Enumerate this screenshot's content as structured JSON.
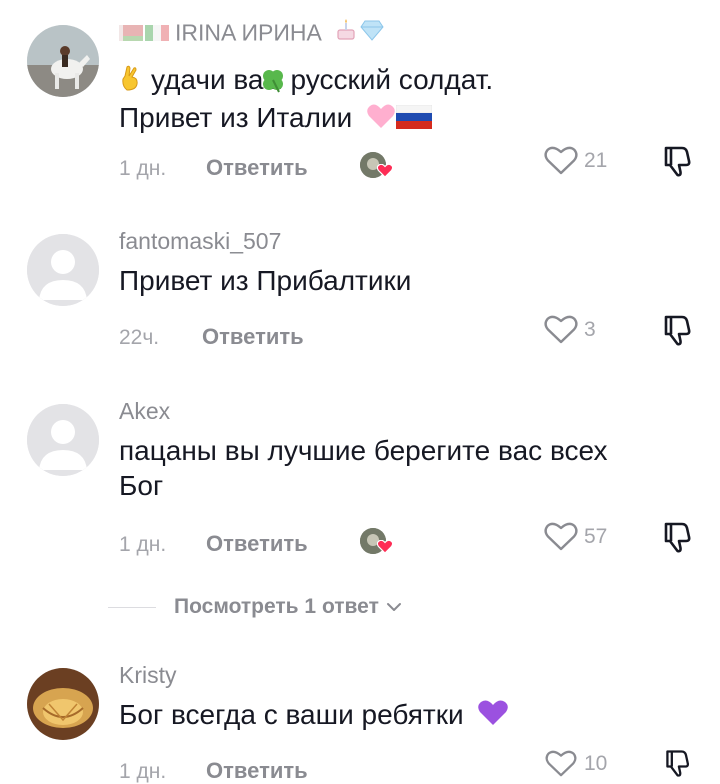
{
  "comments": [
    {
      "username": "IRINA ИРИНА",
      "text_line1": "удачи   вам русский солдат.",
      "text_line2": "Привет из Италии",
      "time": "1 дн.",
      "reply_label": "Ответить",
      "likes": "21",
      "creator_liked": true
    },
    {
      "username": "fantomaski_507",
      "text_line1": "Привет из Прибалтики",
      "time": "22ч.",
      "reply_label": "Ответить",
      "likes": "3"
    },
    {
      "username": "Akex",
      "text_line1": "пацаны вы лучшие берегите вас всех",
      "text_line2": "Бог",
      "time": "1 дн.",
      "reply_label": "Ответить",
      "likes": "57",
      "creator_liked": true
    },
    {
      "username": "Kristy",
      "text_line1": "Бог всегда с ваши ребятки",
      "time": "1 дн.",
      "reply_label": "Ответить",
      "likes": "10"
    }
  ],
  "view_replies": {
    "label": "Посмотреть 1 ответ"
  },
  "icons": [
    "heart-outline-icon",
    "dislike-icon",
    "chevron-down-icon",
    "creator-liked-heart-icon"
  ],
  "colors": {
    "text": "#161823",
    "secondary": "#8a8b91",
    "muted": "#a4a5ab",
    "heart": "#fe2c55"
  }
}
